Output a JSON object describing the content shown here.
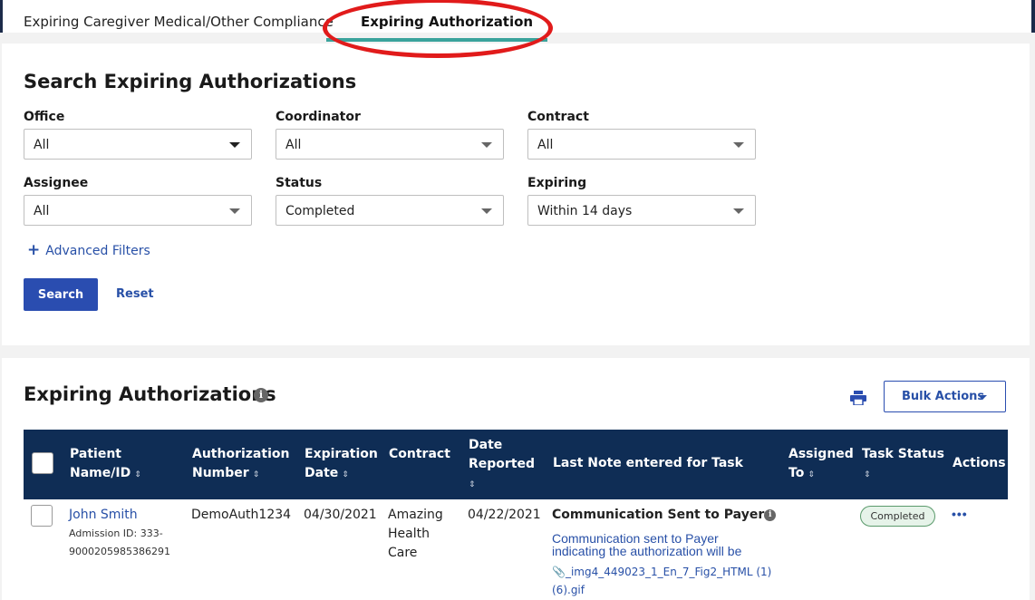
{
  "tabs": [
    {
      "label": "Expiring Caregiver Medical/Other Compliance"
    },
    {
      "label": "Expiring Authorization"
    }
  ],
  "search": {
    "title": "Search Expiring Authorizations",
    "filters": [
      {
        "label": "Office",
        "value": "All"
      },
      {
        "label": "Coordinator",
        "value": "All"
      },
      {
        "label": "Contract",
        "value": "All"
      },
      {
        "label": "Assignee",
        "value": "All"
      },
      {
        "label": "Status",
        "value": "Completed"
      },
      {
        "label": "Expiring",
        "value": "Within 14 days"
      }
    ],
    "advanced_filters": "Advanced Filters",
    "search_label": "Search",
    "reset_label": "Reset"
  },
  "list": {
    "title": "Expiring Authorizations",
    "bulk_actions": "Bulk Actions",
    "columns": [
      {
        "line1": "Patient",
        "line2": "Name/ID",
        "sort": "⇕"
      },
      {
        "line1": "Authorization",
        "line2": "Number",
        "sort": "⇕"
      },
      {
        "line1": "Expiration",
        "line2": "Date",
        "sort": "⇕"
      },
      {
        "line1": "Contract",
        "line2": "",
        "sort": ""
      },
      {
        "line1": "Date",
        "line2": "Reported",
        "sort": "⇕"
      },
      {
        "line1": "Last Note entered for Task",
        "line2": "",
        "sort": ""
      },
      {
        "line1": "Assigned",
        "line2": "To",
        "sort": "⇕"
      },
      {
        "line1": "Task Status",
        "line2": "",
        "sort": "⇕"
      },
      {
        "line1": "Actions",
        "line2": "",
        "sort": ""
      }
    ],
    "rows": [
      {
        "patient_name": "John Smith",
        "admission_line1": "Admission ID: 333-",
        "admission_line2": "9000205985386291",
        "auth_number": "DemoAuth1234",
        "expiration_date": "04/30/2021",
        "contract_line1": "Amazing",
        "contract_line2": "Health",
        "contract_line3": "Care",
        "date_reported": "04/22/2021",
        "note_title": "Communication Sent to Payer",
        "note_body": "Communication sent to Payer indicating the authorization will be",
        "attachment_line1": "_img4_449023_1_En_7_Fig2_HTML (1)",
        "attachment_line2": "(6).gif",
        "assigned_to": "",
        "task_status": "Completed",
        "actions": "•••"
      }
    ]
  },
  "colors": {
    "primary": "#2a4db0",
    "header_bg": "#0f2d55",
    "annotation": "#e11b1b",
    "tab_accent": "#3aa39c"
  }
}
